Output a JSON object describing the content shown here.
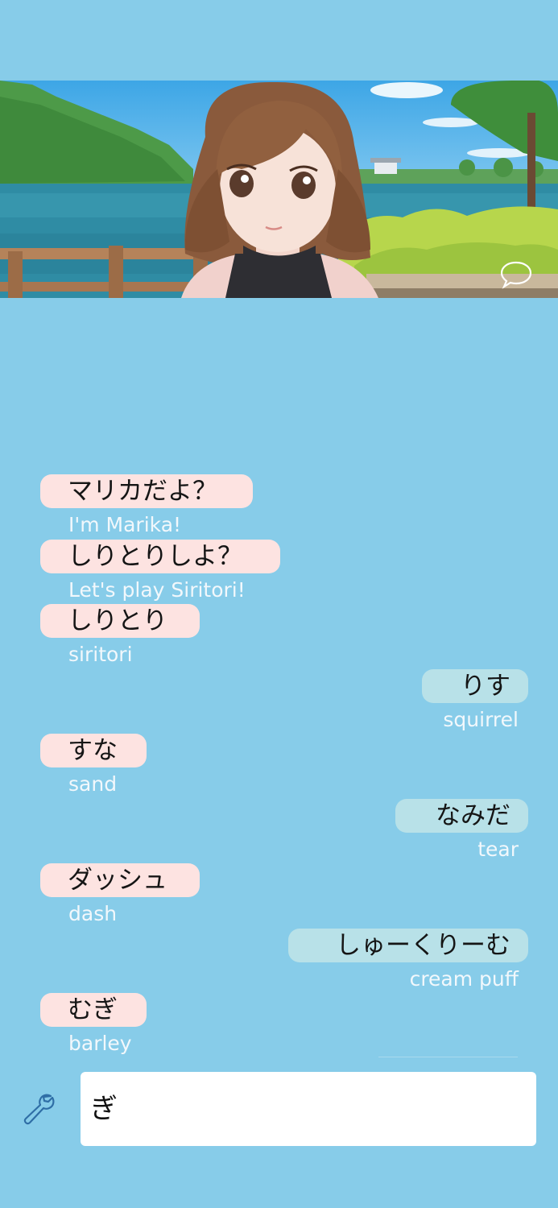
{
  "scene": {
    "character": "Marika",
    "chat_icon": "speech-bubble-icon"
  },
  "messages": [
    {
      "side": "bot",
      "text": "マリカだよ？",
      "translation": "I'm Marika!"
    },
    {
      "side": "bot",
      "text": "しりとりしよ？",
      "translation": "Let's play Siritori!"
    },
    {
      "side": "bot",
      "text": "しりとり",
      "translation": "siritori"
    },
    {
      "side": "user",
      "text": "りす",
      "translation": "squirrel"
    },
    {
      "side": "bot",
      "text": "すな",
      "translation": "sand"
    },
    {
      "side": "user",
      "text": "なみだ",
      "translation": "tear"
    },
    {
      "side": "bot",
      "text": "ダッシュ",
      "translation": "dash"
    },
    {
      "side": "user",
      "text": "しゅーくりーむ",
      "translation": "cream puff"
    },
    {
      "side": "bot",
      "text": "むぎ",
      "translation": "barley"
    }
  ],
  "input": {
    "value": "ぎ",
    "settings_icon": "wrench-icon"
  },
  "colors": {
    "background": "#87cce9",
    "bot_bubble": "#fde3e1",
    "user_bubble": "#b8e1e8",
    "translation_text": "#f2f8fc"
  }
}
